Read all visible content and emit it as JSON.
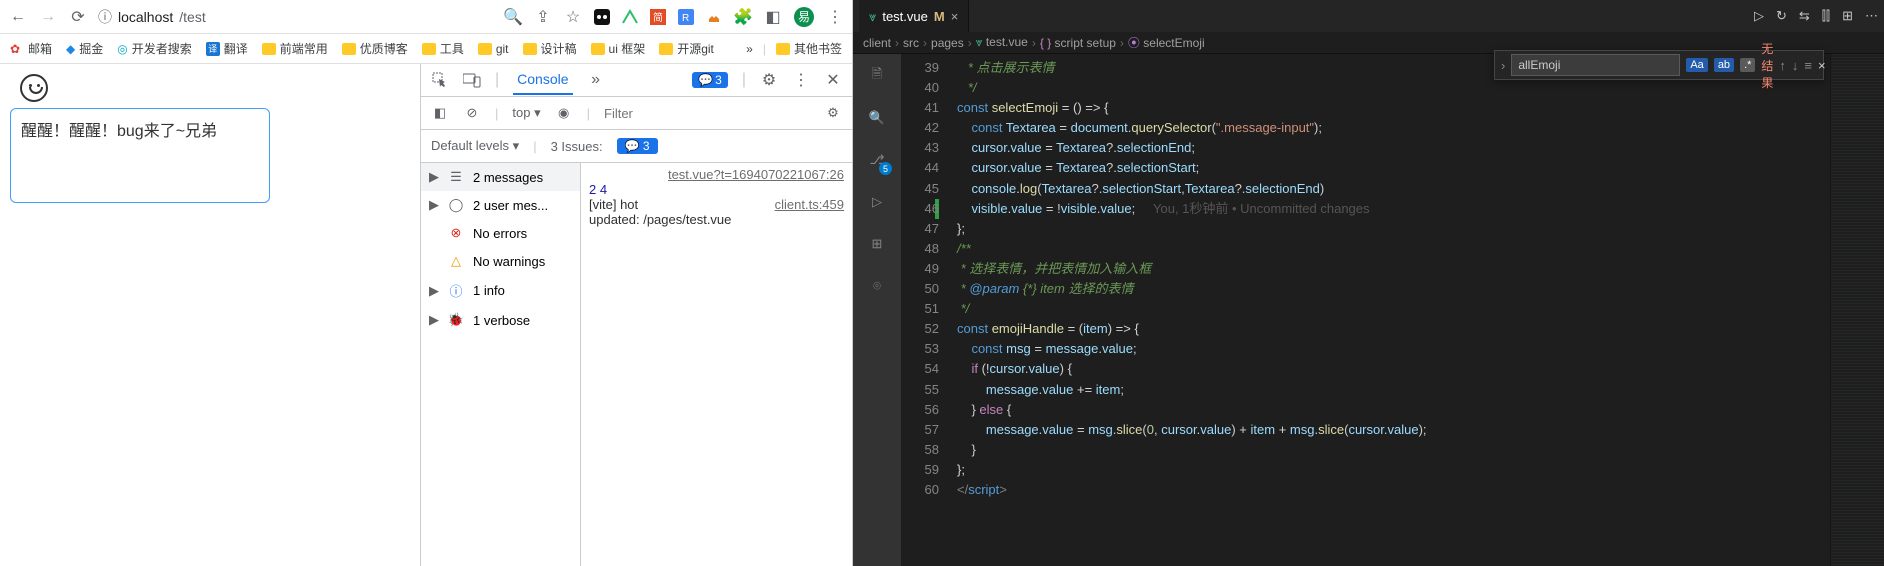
{
  "browser": {
    "url_host": "localhost",
    "url_path": "/test",
    "avatar_letter": "易",
    "bookmarks": [
      {
        "icon": "red",
        "label": "邮箱"
      },
      {
        "icon": "blue",
        "label": "掘金"
      },
      {
        "icon": "cyan",
        "label": "开发者搜索"
      },
      {
        "icon": "teal",
        "label": "翻译"
      },
      {
        "icon": "folder",
        "label": "前端常用"
      },
      {
        "icon": "folder",
        "label": "优质博客"
      },
      {
        "icon": "folder",
        "label": "工具"
      },
      {
        "icon": "folder",
        "label": "git"
      },
      {
        "icon": "folder",
        "label": "设计稿"
      },
      {
        "icon": "folder",
        "label": "ui 框架"
      },
      {
        "icon": "folder",
        "label": "开源git"
      }
    ],
    "bookmarks_more": "»",
    "bookmarks_other": "其他书签",
    "page": {
      "textarea_value": "醒醒！醒醒！bug来了~兄弟"
    }
  },
  "devtools": {
    "tab_active": "Console",
    "chevron": "»",
    "issue_badge": "3",
    "bar2": {
      "context": "top",
      "filter_placeholder": "Filter"
    },
    "bar3": {
      "levels": "Default levels",
      "issues_label": "3 Issues:",
      "issues_count": "3"
    },
    "sidebar": [
      {
        "caret": "▶",
        "icon": "list",
        "text": "2 messages",
        "hl": true
      },
      {
        "caret": "▶",
        "icon": "user",
        "text": "2 user mes...",
        "hl": false
      },
      {
        "caret": "",
        "icon": "err",
        "text": "No errors",
        "hl": false
      },
      {
        "caret": "",
        "icon": "warn",
        "text": "No warnings",
        "hl": false
      },
      {
        "caret": "▶",
        "icon": "info",
        "text": "1 info",
        "hl": false
      },
      {
        "caret": "▶",
        "icon": "bug",
        "text": "1 verbose",
        "hl": false
      }
    ],
    "log_src1": "test.vue?t=1694070221067:26",
    "log_nums": "2 4",
    "log_hmr_1": "[vite] hot",
    "log_src2": "client.ts:459",
    "log_hmr_2": "updated: /pages/test.vue"
  },
  "vscode": {
    "tab_name": "test.vue",
    "tab_mod": "M",
    "title_icons": [
      "▷",
      "↻",
      "⇆",
      "⫿⫿",
      "⊞",
      "⋯"
    ],
    "crumbs": [
      "client",
      "src",
      "pages",
      "test.vue",
      "script setup",
      "selectEmoji"
    ],
    "find_value": "allEmoji",
    "find_result": "无结果",
    "activity_badge": "5",
    "blame": "You, 1秒钟前 • Uncommitted changes",
    "lines": [
      {
        "n": 39,
        "html": "   <span class='cm'>* 点击展示表情</span>"
      },
      {
        "n": 40,
        "html": "   <span class='cm'>*/</span>"
      },
      {
        "n": 41,
        "html": "<span class='kw2'>const</span> <span class='fn'>selectEmoji</span> <span class='op'>=</span> <span class='pn'>() =&gt; {</span>"
      },
      {
        "n": 42,
        "html": "    <span class='kw2'>const</span> <span class='vr'>Textarea</span> <span class='op'>=</span> <span class='vr'>document</span>.<span class='fn'>querySelector</span>(<span class='st'>\".message-input\"</span>);"
      },
      {
        "n": 43,
        "html": "    <span class='vr'>cursor</span>.<span class='vr'>value</span> <span class='op'>=</span> <span class='vr'>Textarea</span>?.<span class='vr'>selectionEnd</span>;"
      },
      {
        "n": 44,
        "html": "    <span class='vr'>cursor</span>.<span class='vr'>value</span> <span class='op'>=</span> <span class='vr'>Textarea</span>?.<span class='vr'>selectionStart</span>;"
      },
      {
        "n": 45,
        "html": "    <span class='vr'>console</span>.<span class='fn'>log</span>(<span class='vr'>Textarea</span>?.<span class='vr'>selectionStart</span>,<span class='vr'>Textarea</span>?.<span class='vr'>selectionEnd</span>)"
      },
      {
        "n": 46,
        "html": "    <span class='vr'>visible</span>.<span class='vr'>value</span> <span class='op'>=</span> !<span class='vr'>visible</span>.<span class='vr'>value</span>;     <span class='blame' data-bind='vscode.blame'></span>",
        "mod": true
      },
      {
        "n": 47,
        "html": "<span class='pn'>};</span>"
      },
      {
        "n": 48,
        "html": "<span class='cm'>/**</span>"
      },
      {
        "n": 49,
        "html": " <span class='cm'>* 选择表情，并把表情加入输入框</span>"
      },
      {
        "n": 50,
        "html": " <span class='cm'>* <span class='kw2'>@param</span> {*} item 选择的表情</span>"
      },
      {
        "n": 51,
        "html": " <span class='cm'>*/</span>"
      },
      {
        "n": 52,
        "html": "<span class='kw2'>const</span> <span class='fn'>emojiHandle</span> <span class='op'>=</span> (<span class='vr'>item</span>) <span class='pn'>=&gt; {</span>"
      },
      {
        "n": 53,
        "html": "    <span class='kw2'>const</span> <span class='vr'>msg</span> <span class='op'>=</span> <span class='vr'>message</span>.<span class='vr'>value</span>;"
      },
      {
        "n": 54,
        "html": "    <span class='kw'>if</span> (!<span class='vr'>cursor</span>.<span class='vr'>value</span>) {"
      },
      {
        "n": 55,
        "html": "        <span class='vr'>message</span>.<span class='vr'>value</span> <span class='op'>+=</span> <span class='vr'>item</span>;"
      },
      {
        "n": 56,
        "html": "    } <span class='kw'>else</span> {"
      },
      {
        "n": 57,
        "html": "        <span class='vr'>message</span>.<span class='vr'>value</span> <span class='op'>=</span> <span class='vr'>msg</span>.<span class='fn'>slice</span>(<span class='nm'>0</span>, <span class='vr'>cursor</span>.<span class='vr'>value</span>) <span class='op'>+</span> <span class='vr'>item</span> <span class='op'>+</span> <span class='vr'>msg</span>.<span class='fn'>slice</span>(<span class='vr'>cursor</span>.<span class='vr'>value</span>);"
      },
      {
        "n": 58,
        "html": "    }"
      },
      {
        "n": 59,
        "html": "<span class='pn'>};</span>"
      },
      {
        "n": 60,
        "html": "<span class='tag'>&lt;/</span><span class='kw2'>script</span><span class='tag'>&gt;</span>"
      }
    ]
  }
}
